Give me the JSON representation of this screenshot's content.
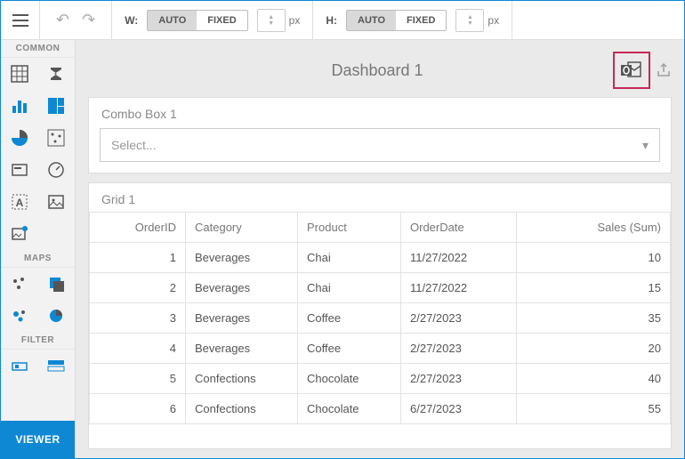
{
  "toolbar": {
    "width_label": "W:",
    "height_label": "H:",
    "auto": "AUTO",
    "fixed": "FIXED",
    "px": "px"
  },
  "sidebar": {
    "section_common": "COMMON",
    "section_maps": "MAPS",
    "section_filter": "FILTER",
    "viewer": "VIEWER"
  },
  "dashboard": {
    "title": "Dashboard 1",
    "combo": {
      "title": "Combo Box 1",
      "placeholder": "Select..."
    },
    "grid": {
      "title": "Grid 1",
      "columns": [
        "OrderID",
        "Category",
        "Product",
        "OrderDate",
        "Sales (Sum)"
      ],
      "rows": [
        {
          "id": "1",
          "cat": "Beverages",
          "prod": "Chai",
          "date": "11/27/2022",
          "sales": "10"
        },
        {
          "id": "2",
          "cat": "Beverages",
          "prod": "Chai",
          "date": "11/27/2022",
          "sales": "15"
        },
        {
          "id": "3",
          "cat": "Beverages",
          "prod": "Coffee",
          "date": "2/27/2023",
          "sales": "35"
        },
        {
          "id": "4",
          "cat": "Beverages",
          "prod": "Coffee",
          "date": "2/27/2023",
          "sales": "20"
        },
        {
          "id": "5",
          "cat": "Confections",
          "prod": "Chocolate",
          "date": "2/27/2023",
          "sales": "40"
        },
        {
          "id": "6",
          "cat": "Confections",
          "prod": "Chocolate",
          "date": "6/27/2023",
          "sales": "55"
        }
      ]
    }
  }
}
